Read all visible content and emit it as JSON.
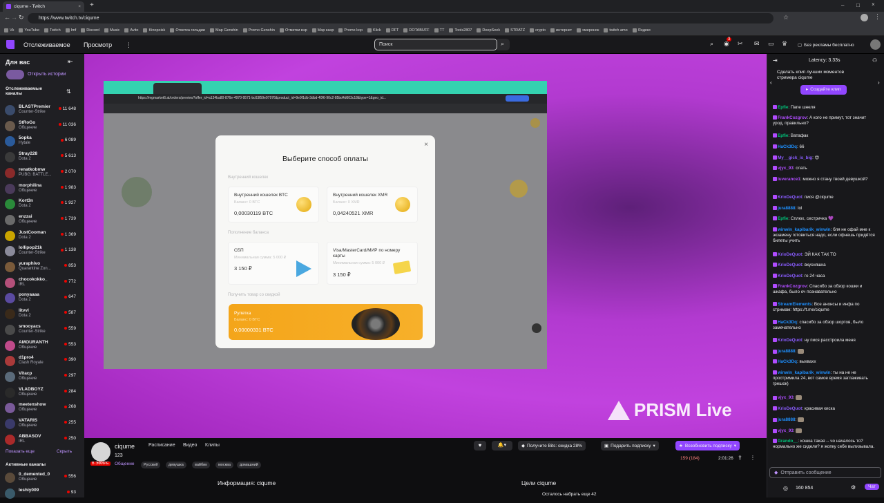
{
  "browser": {
    "tab_title": "ciqume - Twitch",
    "url": "https://www.twitch.tv/ciqume",
    "bookmarks": [
      "Vk",
      "YouTube",
      "Twitch",
      "Imf",
      "Discord",
      "Music",
      "Avito",
      "Kinopoisk",
      "Ответка гильдии",
      "Map Genshin",
      "Promo Genshin",
      "Отметки вэр",
      "Map каэр",
      "Promo kop",
      "Klick",
      "DFT",
      "DOTABUFF",
      "TT",
      "Tools2807",
      "DeepSeek",
      "STRATZ",
      "crypto",
      "интернет",
      "хмеронок",
      "twitch amo",
      "Яндекс"
    ]
  },
  "nav": {
    "following": "Отслеживаемое",
    "browse": "Просмотр",
    "search_placeholder": "Поиск",
    "no_ads": "Без рекламы бесплатно",
    "notif_count": "3"
  },
  "sidebar": {
    "for_you": "Для вас",
    "stories": "Открыть истории",
    "followed_header": "Отслеживаемые каналы",
    "channels": [
      {
        "name": "BLASTPremier",
        "game": "Counter-Strike",
        "viewers": "11 648",
        "color": "#3a4b6b"
      },
      {
        "name": "StRoGo",
        "game": "Общение",
        "viewers": "11 036",
        "color": "#6a5a4c"
      },
      {
        "name": "5opka",
        "game": "Hytale",
        "viewers": "6 089",
        "color": "#2a5a9a"
      },
      {
        "name": "Stray228",
        "game": "Dota 2",
        "viewers": "5 613",
        "color": "#3a3a3a"
      },
      {
        "name": "renatkobmw",
        "game": "PUBG: BATTLE...",
        "viewers": "2 070",
        "color": "#8a2a2a"
      },
      {
        "name": "morphilina",
        "game": "Общение",
        "viewers": "1 983",
        "color": "#4a3a5a"
      },
      {
        "name": "Kort3n",
        "game": "Dota 2",
        "viewers": "1 927",
        "color": "#2a8a3a"
      },
      {
        "name": "enzzai",
        "game": "Общение",
        "viewers": "1 739",
        "color": "#6a6a6a"
      },
      {
        "name": "JustCooman",
        "game": "Dota 2",
        "viewers": "1 369",
        "color": "#c9a400"
      },
      {
        "name": "lollipop21k",
        "game": "Counter-Strike",
        "viewers": "1 138",
        "color": "#8a8a9a"
      },
      {
        "name": "yuraphivo",
        "game": "Quarantine Zon...",
        "viewers": "853",
        "color": "#7a5a3a"
      },
      {
        "name": "chocokokko_",
        "game": "IRL",
        "viewers": "772",
        "color": "#b4507a"
      },
      {
        "name": "ponyaaaa",
        "game": "Dota 2",
        "viewers": "647",
        "color": "#5a4aa0"
      },
      {
        "name": "litvvl",
        "game": "Dota 2",
        "viewers": "587",
        "color": "#3a2a1a"
      },
      {
        "name": "smooyacs",
        "game": "Counter-Strike",
        "viewers": "559",
        "color": "#4a4a4a"
      },
      {
        "name": "AMOURANTH",
        "game": "Общение",
        "viewers": "553",
        "color": "#c04a8a"
      },
      {
        "name": "d1pro4",
        "game": "Clash Royale",
        "viewers": "390",
        "color": "#aa3a3a"
      },
      {
        "name": "Vitacp",
        "game": "Общение",
        "viewers": "297",
        "color": "#5a6a7a"
      },
      {
        "name": "VLADBOYZ",
        "game": "Общение",
        "viewers": "284",
        "color": "#2a2a2a"
      },
      {
        "name": "meetenshow",
        "game": "Общение",
        "viewers": "268",
        "color": "#7a5a9a"
      },
      {
        "name": "VATARIS",
        "game": "Общение",
        "viewers": "255",
        "color": "#3a3a6a"
      },
      {
        "name": "ABBASOV",
        "game": "IRL",
        "viewers": "250",
        "color": "#aa2a2a"
      }
    ],
    "show_more": "Показать еще",
    "hide": "Скрыть",
    "active_header": "Активные каналы",
    "active": [
      {
        "name": "0_demented_0",
        "game": "Общение",
        "viewers": "556",
        "color": "#5a4a3a"
      },
      {
        "name": "leshiy009",
        "game": "",
        "viewers": "93",
        "color": "#3a5a6a"
      }
    ]
  },
  "video": {
    "watermark": "PRISM Live",
    "inner_url": "https://mgmarket6.at/orders/preview?offer_id=a134ba80-876e-4970-9571-bc63f59e07976&product_id=9e9f1db-3dbd-40f6-90c2-85bd4d603c18&type=1&geo_id...",
    "modal": {
      "title": "Выберите способ оплаты",
      "internal_wallet": "Внутренний кошелек",
      "topup": "Пополнение баланса",
      "discount": "Получить товар со скидкой",
      "btc_title": "Внутренний кошелек BTC",
      "btc_balance": "Баланс: 0 BTC",
      "btc_value": "0,00030119 BTC",
      "xmr_title": "Внутренний кошелек XMR",
      "xmr_balance": "Баланс: 0 XMR",
      "xmr_value": "0,04240521 XMR",
      "sbp_title": "СБП",
      "sbp_min": "Минимальная сумма: 5 000 ₽",
      "sbp_value": "3 150 ₽",
      "card_title": "Visa/MasterCard/МИР по номеру карты",
      "card_min": "Минимальная сумма: 5 000 ₽",
      "card_value": "3 150 ₽",
      "roulette_title": "Рулетка",
      "roulette_balance": "Баланс: 0 BTC",
      "roulette_value": "0,00000331 BTC"
    }
  },
  "stream": {
    "channel": "ciqume",
    "tabs": [
      "Расписание",
      "Видео",
      "Клипы"
    ],
    "viewers_small": "123",
    "live": "В ЭФИРЕ",
    "category": "Общение",
    "tags": [
      "Русский",
      "девушка",
      "вайбик",
      "москва",
      "домашний"
    ],
    "bits": "Получите Bits: скидка 28%",
    "subscribe": "Подарить подписку",
    "resub": "Возобновить подписку",
    "viewer_count": "159 (184)",
    "uptime": "2:01:26",
    "about": "Информация: ciqume",
    "goals": "Цели ciqume",
    "goal_text": "Осталось набрать еще 42"
  },
  "chat": {
    "latency": "Latency: 3.33s",
    "clip_prompt": "Сделать клип лучших моментов стримера ciqume",
    "clip_btn": "Создайте клип",
    "messages": [
      {
        "user": "Epfie",
        "cls": "u4",
        "text": "Папе шнеля"
      },
      {
        "user": "FrankCozgrov",
        "cls": "u1",
        "text": "А кого не примут, тот значит урод, правильно?"
      },
      {
        "user": "Epfie",
        "cls": "u4",
        "text": "Ватафак"
      },
      {
        "user": "HaCk3Dq",
        "cls": "u2",
        "text": "66"
      },
      {
        "user": "My__gick_is_big",
        "cls": "u3",
        "text": "😍"
      },
      {
        "user": "vjyx_93",
        "cls": "u1",
        "text": "слать"
      },
      {
        "user": "luverance1",
        "cls": "u1",
        "text": "можно я стану твоей девушкой?"
      },
      {
        "user": "KrioDeQuot",
        "cls": "u3",
        "text": "пися @ciqume"
      },
      {
        "user": "jura8888",
        "cls": "u2",
        "text": "lol"
      },
      {
        "user": "Epfie",
        "cls": "u4",
        "text": "Сплюх, сестричка 💜"
      },
      {
        "user": "winwin_kapibarik_winwin",
        "cls": "u2",
        "text": "бля не офай мне к экзамену готовиться надо, если офнешь придётся билеты учить"
      },
      {
        "user": "KrioDeQuot",
        "cls": "u3",
        "text": "ЭЙ КАК ТАК ТО"
      },
      {
        "user": "KrioDeQuot",
        "cls": "u3",
        "text": "вкусняшка"
      },
      {
        "user": "KrioDeQuot",
        "cls": "u3",
        "text": "го 24 часа"
      },
      {
        "user": "FrankCozgrov",
        "cls": "u1",
        "text": "Спасибо за обзор кошки и шкафа, было оч познавательно"
      },
      {
        "user": "StreamElements",
        "cls": "u2",
        "text": "Все анонсы и инфа по стримам: https://t.me/ciqume"
      },
      {
        "user": "HaCk3Dq",
        "cls": "u2",
        "text": "спасибо за обзор шортов, было замечательно"
      },
      {
        "user": "KrioDeQuot",
        "cls": "u3",
        "text": "ну пися расстроила меня"
      },
      {
        "user": "jura8888",
        "cls": "u2",
        "text": ""
      },
      {
        "user": "HaCk3Dq",
        "cls": "u2",
        "text": "выхвахх"
      },
      {
        "user": "winwin_kapibarik_winwin",
        "cls": "u2",
        "text": "ты на не не простримила 24, вот самое время заглаживать грешок)"
      },
      {
        "user": "vjyx_93",
        "cls": "u1",
        "text": ""
      },
      {
        "user": "KrioDeQuot",
        "cls": "u3",
        "text": "красивая киска"
      },
      {
        "user": "jura8888",
        "cls": "u2",
        "text": ""
      },
      {
        "user": "vjyx_93",
        "cls": "u1",
        "text": ""
      },
      {
        "user": "Grando__",
        "cls": "u4",
        "text": "кошка такая -- чо началось то? нормально же сидели? я жопку себе вылизывала."
      }
    ],
    "input_placeholder": "Отправить сообщение",
    "points": "160 854",
    "chat_btn": "Чат"
  }
}
